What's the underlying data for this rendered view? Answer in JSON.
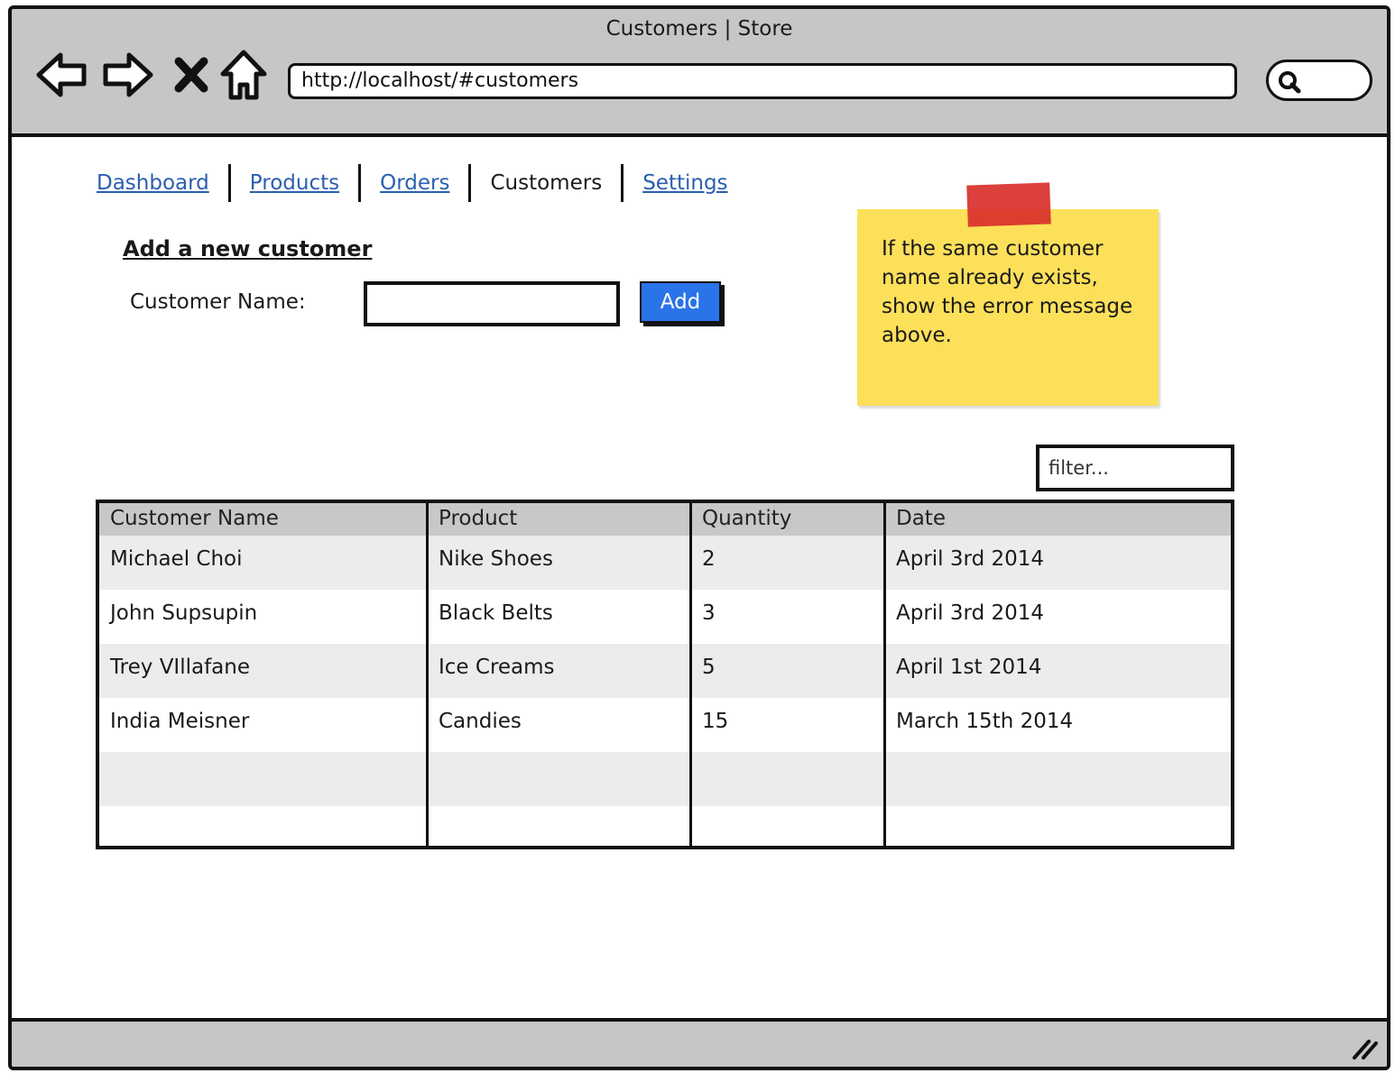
{
  "window": {
    "title": "Customers | Store"
  },
  "browser": {
    "url": "http://localhost/#customers",
    "icons": [
      "back-icon",
      "forward-icon",
      "stop-icon",
      "home-icon",
      "search-icon"
    ]
  },
  "nav": {
    "tabs": [
      {
        "label": "Dashboard",
        "active": false
      },
      {
        "label": "Products",
        "active": false
      },
      {
        "label": "Orders",
        "active": false
      },
      {
        "label": "Customers",
        "active": true
      },
      {
        "label": "Settings",
        "active": false
      }
    ]
  },
  "form": {
    "heading": "Add a new customer",
    "name_label": "Customer Name:",
    "name_value": "",
    "add_label": "Add"
  },
  "note": {
    "text": "If the same customer name already exists, show the error message above."
  },
  "filter": {
    "placeholder": "filter..."
  },
  "table": {
    "headers": [
      "Customer Name",
      "Product",
      "Quantity",
      "Date"
    ],
    "rows": [
      [
        "Michael Choi",
        "Nike Shoes",
        "2",
        "April 3rd 2014"
      ],
      [
        "John Supsupin",
        "Black Belts",
        "3",
        "April 3rd 2014"
      ],
      [
        "Trey VIllafane",
        "Ice Creams",
        "5",
        "April 1st 2014"
      ],
      [
        "India Meisner",
        "Candies",
        "15",
        "March 15th 2014"
      ],
      [
        "",
        "",
        "",
        ""
      ],
      [
        "",
        "",
        "",
        ""
      ]
    ]
  },
  "colors": {
    "chrome": "#c6c6c6",
    "link": "#2a5fb0",
    "button": "#2a73e8",
    "sticky": "#fde05a",
    "tape": "#d8302b",
    "row_alt": "#ececec",
    "header": "#c8c8c8"
  }
}
